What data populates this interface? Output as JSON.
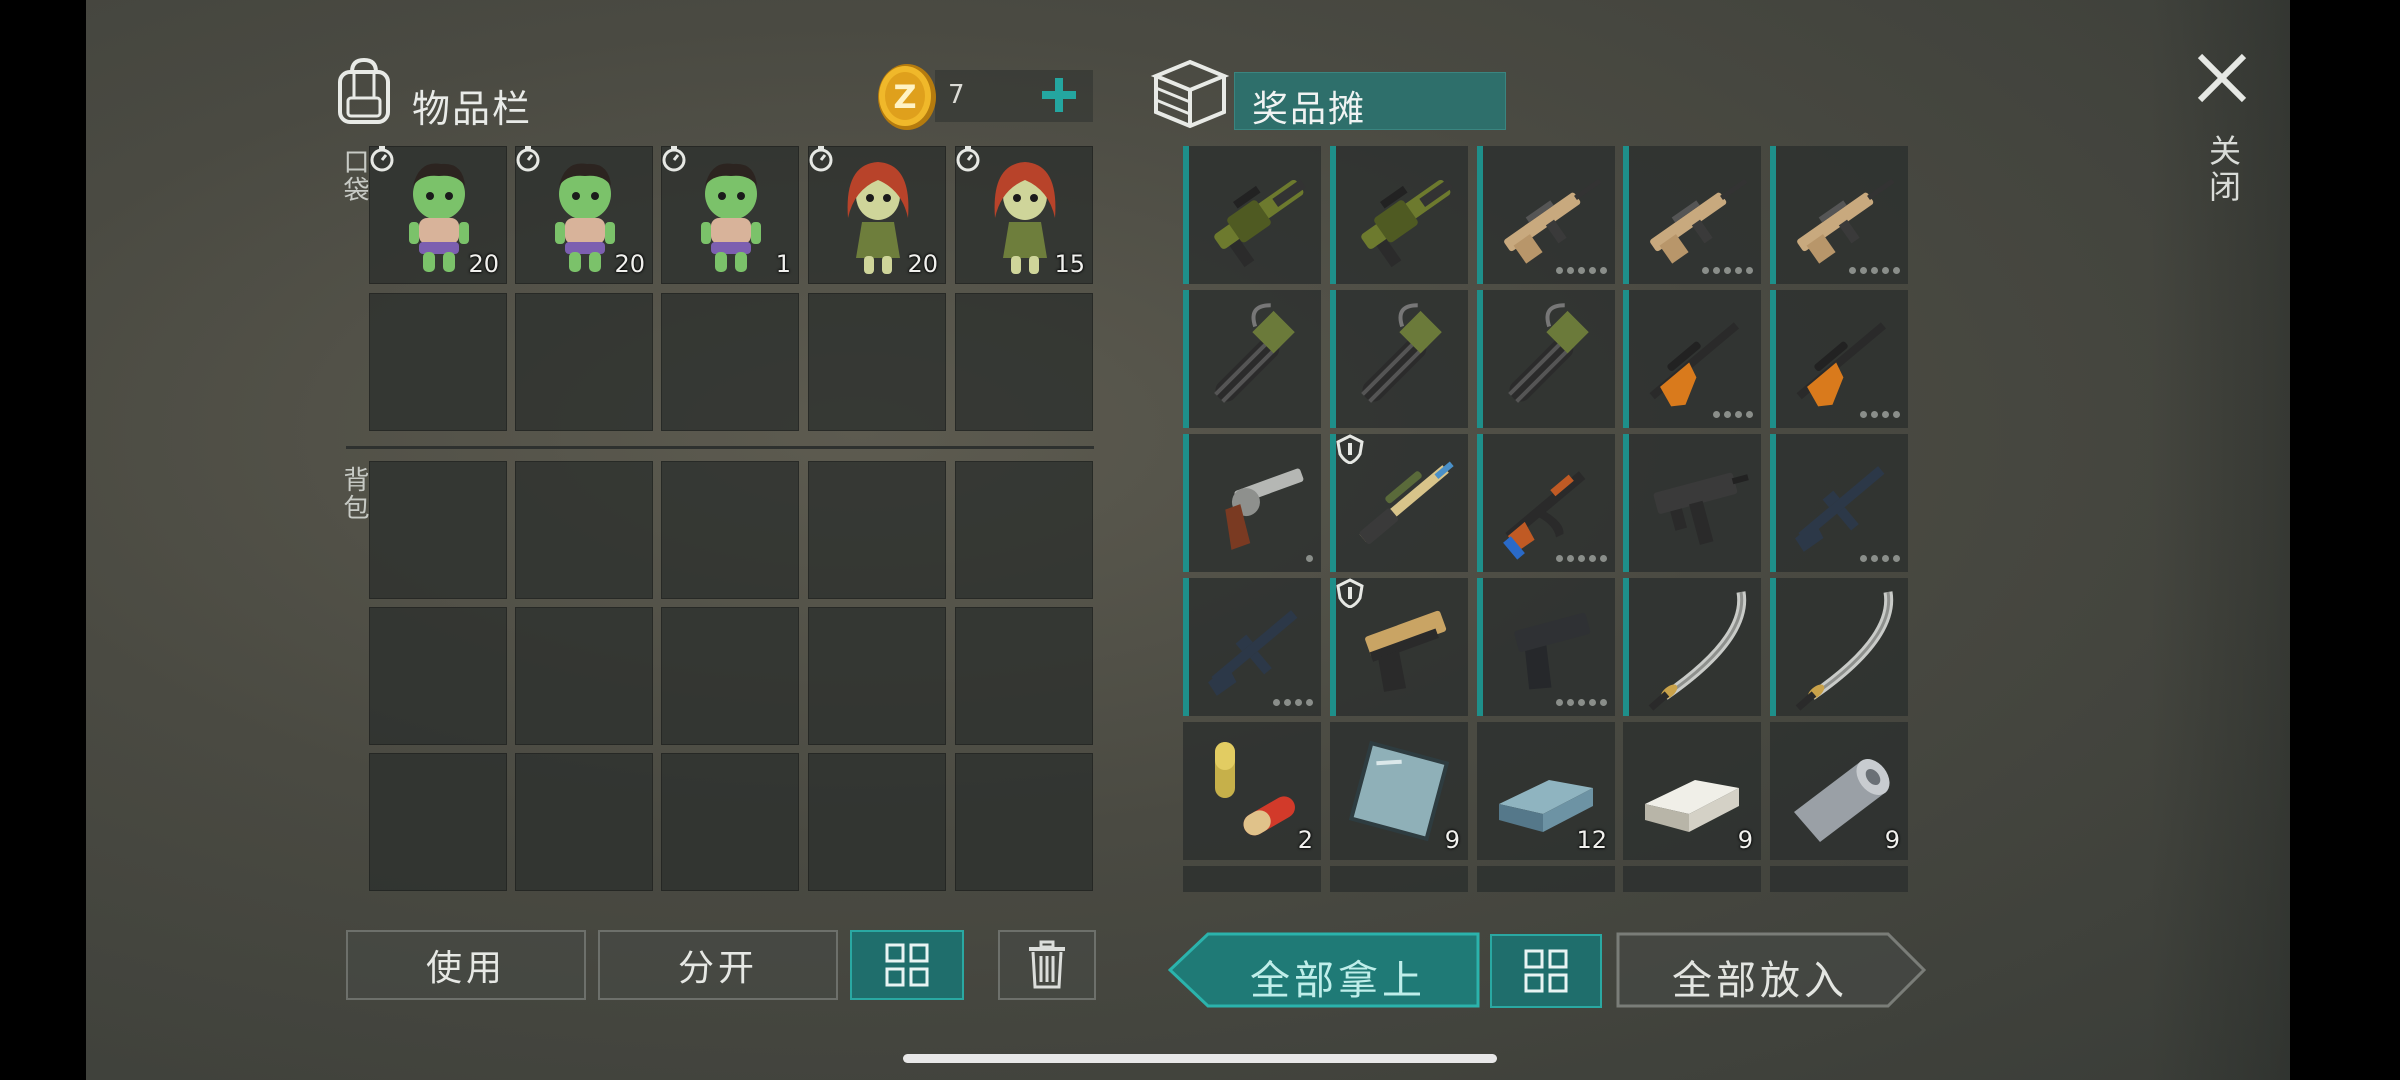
{
  "inventory": {
    "title": "物品栏",
    "coins": "7",
    "pocket_label": "口袋",
    "backpack_label": "背包",
    "pocket_items": [
      {
        "name": "zombie-doll-boy",
        "count": "20"
      },
      {
        "name": "zombie-doll-boy",
        "count": "20"
      },
      {
        "name": "zombie-doll-boy",
        "count": "1"
      },
      {
        "name": "zombie-doll-girl",
        "count": "20"
      },
      {
        "name": "zombie-doll-girl",
        "count": "15"
      }
    ]
  },
  "crate": {
    "title": "奖品摊",
    "items": [
      {
        "icon": "grenade-launcher-icon"
      },
      {
        "icon": "grenade-launcher-icon"
      },
      {
        "icon": "assault-rifle-tan-icon"
      },
      {
        "icon": "assault-rifle-tan-icon"
      },
      {
        "icon": "assault-rifle-tan-icon"
      },
      {
        "icon": "minigun-icon"
      },
      {
        "icon": "minigun-icon"
      },
      {
        "icon": "minigun-icon"
      },
      {
        "icon": "hunting-rifle-icon"
      },
      {
        "icon": "hunting-rifle-icon"
      },
      {
        "icon": "revolver-icon"
      },
      {
        "icon": "sniper-rifle-icon"
      },
      {
        "icon": "ak-rifle-icon"
      },
      {
        "icon": "uzi-icon"
      },
      {
        "icon": "m16-rifle-icon"
      },
      {
        "icon": "m16-rifle-icon"
      },
      {
        "icon": "desert-eagle-icon"
      },
      {
        "icon": "pistol-icon"
      },
      {
        "icon": "katana-icon"
      },
      {
        "icon": "katana-icon"
      },
      {
        "icon": "pills-icon",
        "count": "2"
      },
      {
        "icon": "glass-sheet-icon",
        "count": "9"
      },
      {
        "icon": "steel-ingot-icon",
        "count": "12"
      },
      {
        "icon": "aluminum-ingot-icon",
        "count": "9"
      },
      {
        "icon": "tin-roll-icon",
        "count": "9"
      }
    ]
  },
  "buttons": {
    "use": "使用",
    "split": "分开",
    "take_all": "全部拿上",
    "put_all": "全部放入"
  },
  "close": {
    "label": "关闭"
  },
  "colors": {
    "teal": "#1f6e6c",
    "teal_border": "#2aa8a2",
    "coin": "#e2a21c"
  }
}
